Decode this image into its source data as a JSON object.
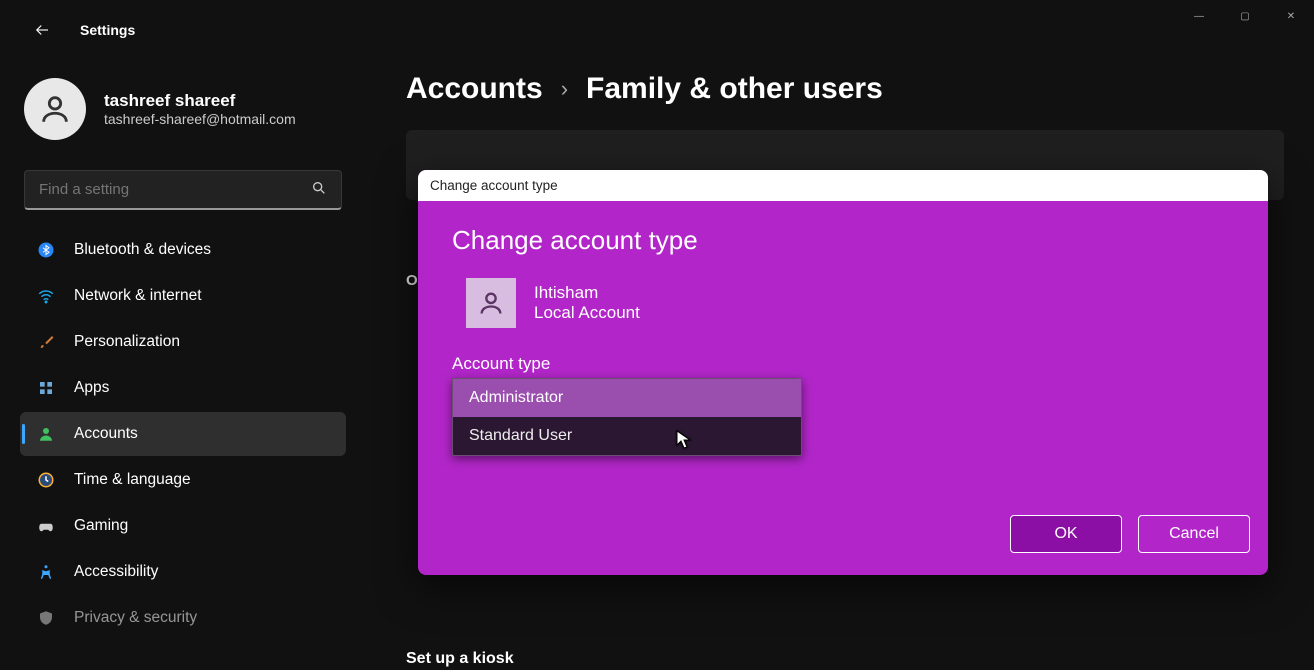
{
  "app": {
    "title": "Settings"
  },
  "window": {
    "min": "—",
    "max": "▢",
    "close": "✕"
  },
  "user": {
    "name": "tashreef shareef",
    "email": "tashreef-shareef@hotmail.com"
  },
  "search": {
    "placeholder": "Find a setting"
  },
  "nav": [
    {
      "label": "Bluetooth & devices",
      "iconColor": "#2b86f5"
    },
    {
      "label": "Network & internet",
      "iconColor": "#1aa6e8"
    },
    {
      "label": "Personalization",
      "iconColor": "#d07a3a"
    },
    {
      "label": "Apps",
      "iconColor": "#6da8d6"
    },
    {
      "label": "Accounts",
      "iconColor": "#40c060"
    },
    {
      "label": "Time & language",
      "iconColor": "#ffb030"
    },
    {
      "label": "Gaming",
      "iconColor": "#cccccc"
    },
    {
      "label": "Accessibility",
      "iconColor": "#3ba7ff"
    },
    {
      "label": "Privacy & security",
      "iconColor": "#cccccc"
    }
  ],
  "breadcrumb": {
    "parent": "Accounts",
    "sep": "›",
    "current": "Family & other users"
  },
  "main": {
    "otherLabel": "O",
    "kiosk": "Set up a kiosk"
  },
  "modal": {
    "titlebar": "Change account type",
    "heading": "Change account type",
    "user": {
      "name": "Ihtisham",
      "type": "Local Account"
    },
    "label": "Account type",
    "options": {
      "admin": "Administrator",
      "standard": "Standard User"
    },
    "ok": "OK",
    "cancel": "Cancel"
  }
}
